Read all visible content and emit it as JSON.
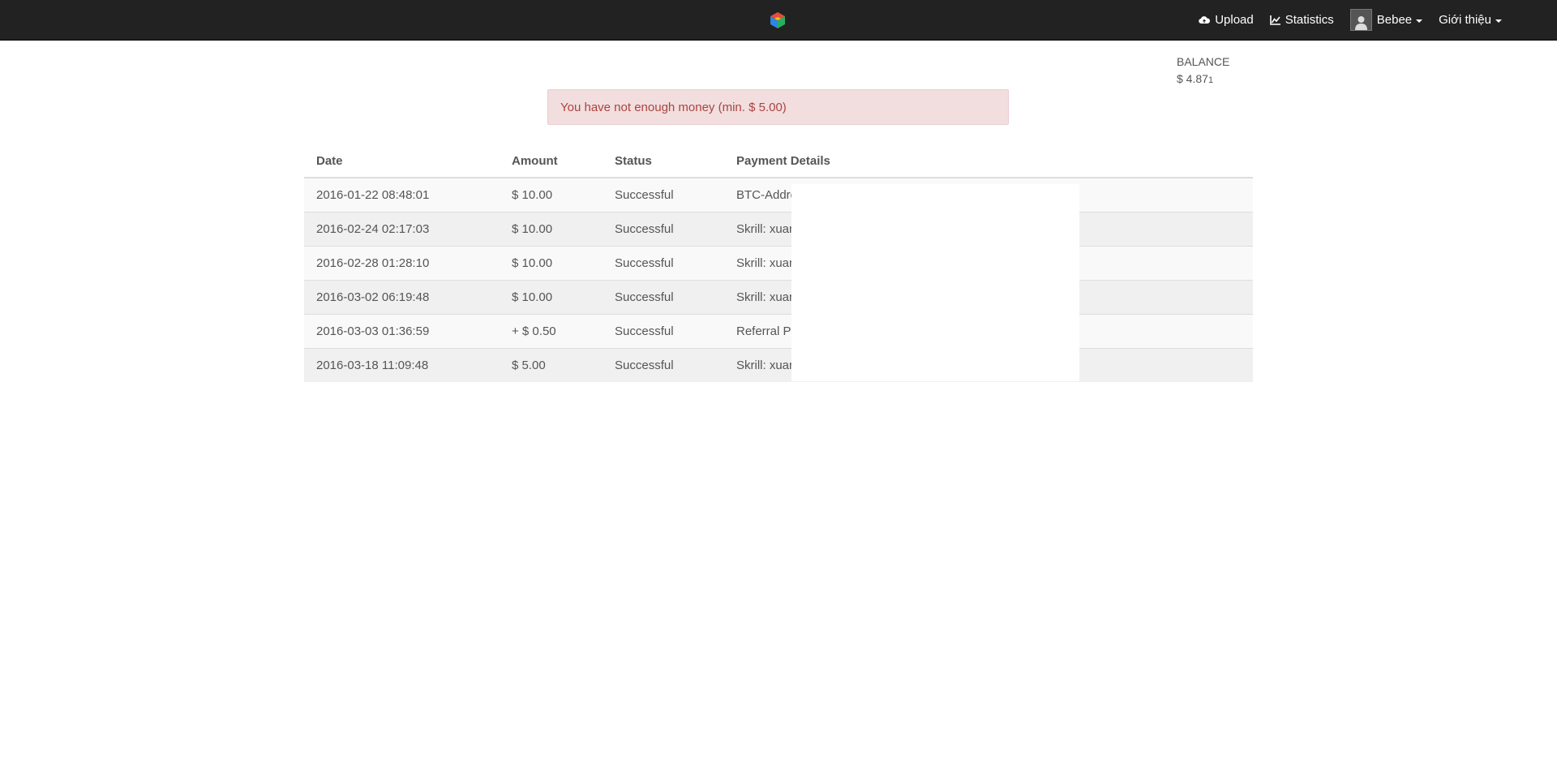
{
  "nav": {
    "upload_label": "Upload",
    "statistics_label": "Statistics",
    "user_label": "Bebee",
    "about_label": "Giới thiệu"
  },
  "balance": {
    "label": "BALANCE",
    "value": "$ 4.87",
    "value_suffix": "1"
  },
  "alert": {
    "message": "You have not enough money (min. $ 5.00)"
  },
  "table": {
    "headers": [
      "Date",
      "Amount",
      "Status",
      "Payment Details"
    ],
    "rows": [
      {
        "date": "2016-01-22 08:48:01",
        "amount": "$ 10.00",
        "status": "Successful",
        "details": "BTC-Addre"
      },
      {
        "date": "2016-02-24 02:17:03",
        "amount": "$ 10.00",
        "status": "Successful",
        "details": "Skrill: xuan"
      },
      {
        "date": "2016-02-28 01:28:10",
        "amount": "$ 10.00",
        "status": "Successful",
        "details": "Skrill: xuan"
      },
      {
        "date": "2016-03-02 06:19:48",
        "amount": "$ 10.00",
        "status": "Successful",
        "details": "Skrill: xuan"
      },
      {
        "date": "2016-03-03 01:36:59",
        "amount": "+ $ 0.50",
        "status": "Successful",
        "details": "Referral Pr"
      },
      {
        "date": "2016-03-18 11:09:48",
        "amount": "$ 5.00",
        "status": "Successful",
        "details": "Skrill: xuan"
      }
    ]
  },
  "colors": {
    "navbar_bg": "#222222",
    "alert_bg": "#f2dede",
    "alert_text": "#a94442"
  },
  "icons": {
    "logo": "cube-logo-icon",
    "upload": "cloud-upload-icon",
    "statistics": "chart-icon",
    "user": "user-avatar-icon"
  }
}
